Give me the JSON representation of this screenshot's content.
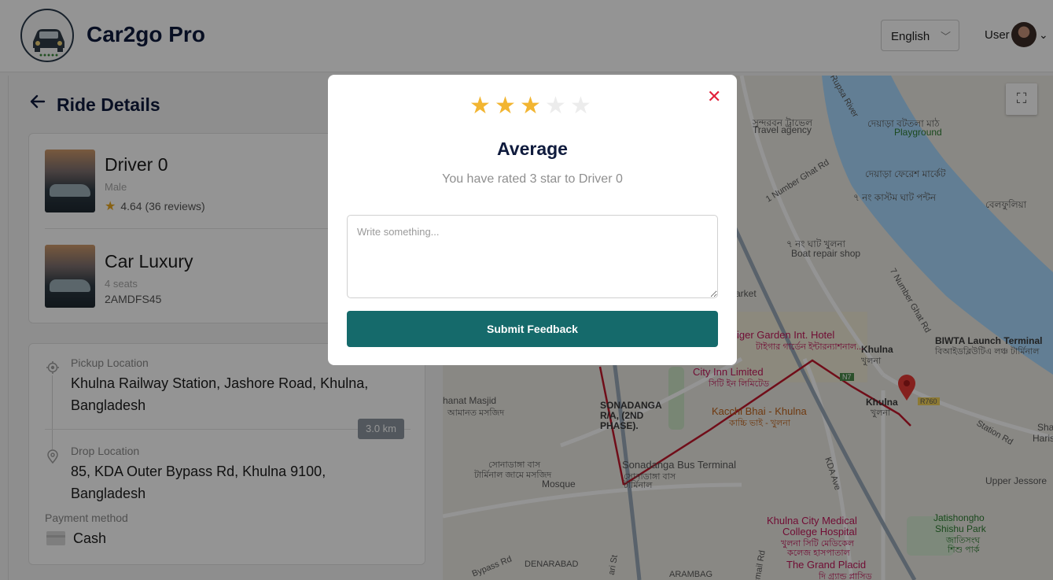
{
  "header": {
    "brand": "Car2go Pro",
    "language": "English",
    "user_label": "User"
  },
  "page": {
    "title": "Ride Details"
  },
  "driver": {
    "name": "Driver 0",
    "gender": "Male",
    "rating": "4.64 (36 reviews)"
  },
  "car": {
    "name": "Car Luxury",
    "seats": "4 seats",
    "plate": "2AMDFS45"
  },
  "trip": {
    "pickup_label": "Pickup Location",
    "pickup_value": "Khulna Railway Station, Jashore Road, Khulna, Bangladesh",
    "distance": "3.0 km",
    "drop_label": "Drop Location",
    "drop_value": "85, KDA Outer Bypass Rd, Khulna 9100, Bangladesh",
    "payment_label": "Payment method",
    "payment_value": "Cash"
  },
  "map": {
    "labels": {
      "travel_bn": "সুন্দরবন ট্রাভেল",
      "travel": "Travel agency",
      "river": "Rupsa River",
      "playground_bn": "দেয়াড়া বটতলা মাঠ",
      "playground": "Playground",
      "number_ghat_rd": "1 Number Ghat Rd",
      "market_bn": "দেয়াড়া ফেরেশ মার্কেট",
      "ghat7_bn": "৭ নং কাস্টম ঘাট পন্টন",
      "ghat7_ne_bn": "৭ নং ঘাট খুলনা",
      "boat_repair": "Boat repair shop",
      "number7_ghat_rd": "7 Number Ghat Rd",
      "belphulia_bn": "বেলফুলিয়া",
      "market": "arket",
      "biwta": "BIWTA Launch Terminal",
      "biwta_bn": "বিআইডব্লিউটিএ লঞ্চ টার্মিনাল",
      "khulna": "Khulna",
      "khulna_bn": "খুলনা",
      "tiger_garden": "iger Garden Int. Hotel",
      "tiger_garden_bn": "টাইগার গার্ডেন ইন্টারন্যাশনাল...",
      "city_inn": "City Inn Limited",
      "city_inn_bn": "সিটি ইন লিমিটেড",
      "kacchi_bhai": "Kacchi Bhai - Khulna",
      "kacchi_bhai_bn": "কাচ্চি ভাই - খুলনা",
      "khulna_station": "Khulna",
      "khulna_station_bn": "খুলনা",
      "masjid": "hanat Masjid",
      "masjid_bn": "আমানত মসজিদ",
      "sonadanga": "SONADANGA",
      "sonadanga2": "R/A, (2ND",
      "sonadanga3": "PHASE).",
      "bus_terminal": "Sonadanga Bus Terminal",
      "bus_terminal_bn": "সোনাডাঙ্গা বাস",
      "bus_terminal_bn2": "টার্মিনাল",
      "mosque_bn": "সোনাডাঙ্গা বাস",
      "mosque_bn2": "টার্মিনাল জামে মসজিদ",
      "mosque": "Mosque",
      "kda_ave": "KDA Ave",
      "station_rd": "Station Rd",
      "upper_jessore": "Upper Jessore",
      "medical": "Khulna City Medical",
      "medical2": "College Hospital",
      "medical_bn": "খুলনা সিটি মেডিকেল",
      "medical_bn2": "কলেজ হাসপাতাল",
      "jatishongho": "Jatishongho",
      "shishu_park": "Shishu Park",
      "shishu_bn": "জাতিসংঘ",
      "shishu_bn2": "শিশু পার্ক",
      "grand_placid": "The Grand Placid",
      "grand_placid_bn": "দি গ্র্যান্ড প্লাসিড",
      "bypass_rd": "Bypass Rd",
      "denarabad": "DENARABAD",
      "arambag": "ARAMBAG",
      "ismail_rd": "Ismail Rd",
      "sari_st": "ari St",
      "shahid_harris": "Sha",
      "harris": "Haris",
      "r760": "R760",
      "n7": "N7"
    }
  },
  "modal": {
    "rating_value": 3,
    "rating_max": 5,
    "rating_title": "Average",
    "rating_subtitle": "You have rated 3 star to Driver 0",
    "feedback_placeholder": "Write something...",
    "submit_label": "Submit Feedback"
  }
}
